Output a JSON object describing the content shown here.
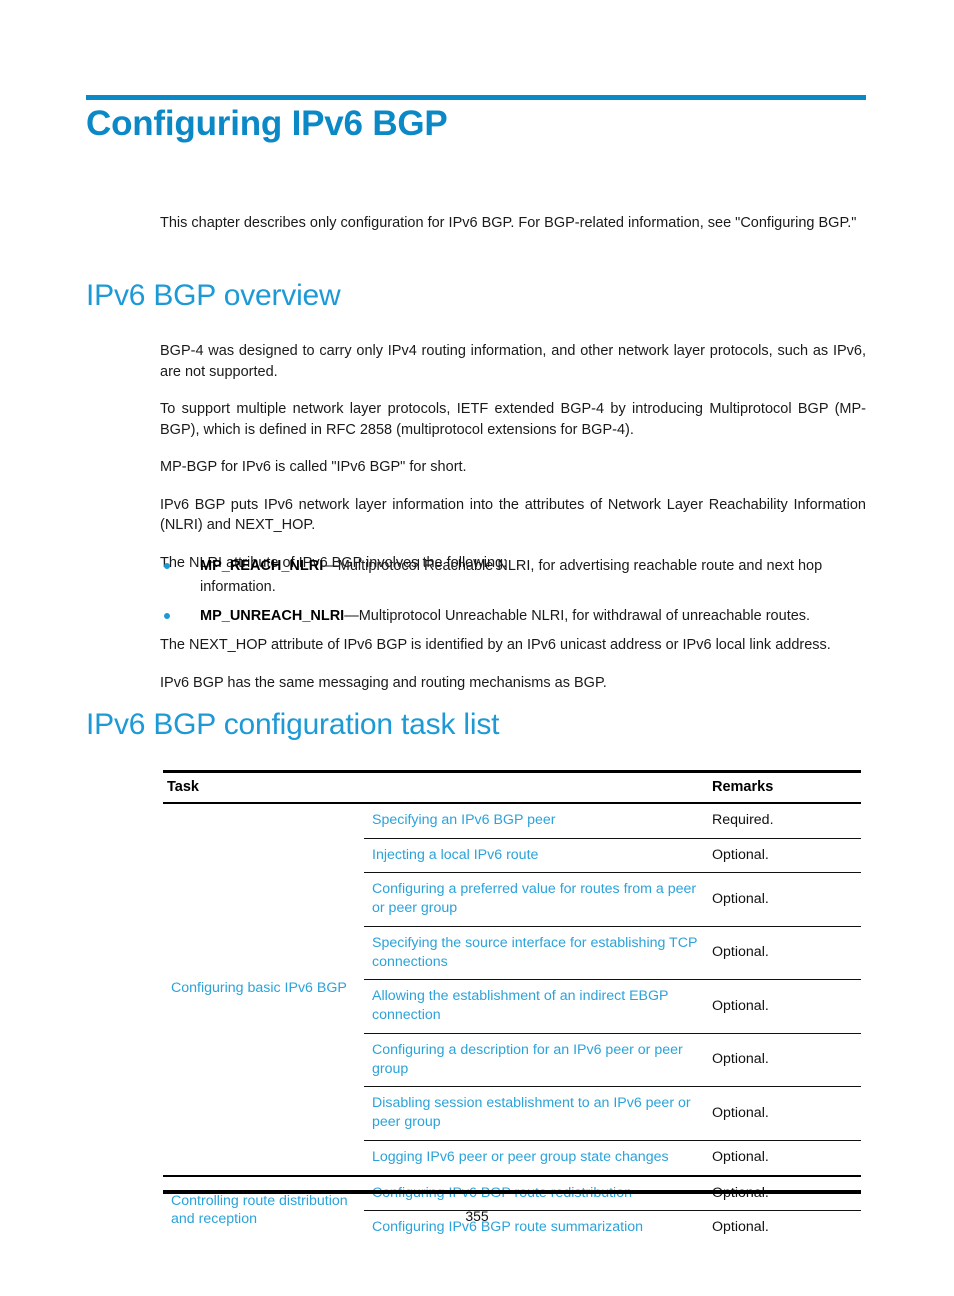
{
  "colors": {
    "chapter_blue": "#0b88c6",
    "heading_blue": "#1d9ad6",
    "link_blue": "#2ba3da",
    "rule_black": "#000000"
  },
  "chapter": {
    "title": "Configuring IPv6 BGP",
    "intro": "This chapter describes only configuration for IPv6 BGP. For BGP-related information, see \"Configuring BGP.\""
  },
  "overview": {
    "heading": "IPv6 BGP overview",
    "paragraphs": [
      "BGP-4 was designed to carry only IPv4 routing information, and other network layer protocols, such as IPv6, are not supported.",
      "To support multiple network layer protocols, IETF extended BGP-4 by introducing Multiprotocol BGP (MP-BGP), which is defined in RFC 2858 (multiprotocol extensions for BGP-4).",
      "MP-BGP for IPv6 is called \"IPv6 BGP\" for short.",
      "IPv6 BGP puts IPv6 network layer information into the attributes of Network Layer Reachability Information (NLRI) and NEXT_HOP.",
      "The NLRI attribute of IPv6 BGP involves the following:"
    ],
    "bullets": [
      {
        "term": "MP_REACH_NLRI",
        "text": "—Multiprotocol Reachable NLRI, for advertising reachable route and next hop information."
      },
      {
        "term": "MP_UNREACH_NLRI",
        "text": "—Multiprotocol Unreachable NLRI, for withdrawal of unreachable routes."
      }
    ],
    "paragraphs_after": [
      "The NEXT_HOP attribute of IPv6 BGP is identified by an IPv6 unicast address or IPv6 local link address.",
      "IPv6 BGP has the same messaging and routing mechanisms as BGP."
    ]
  },
  "task_list": {
    "heading": "IPv6 BGP configuration task list",
    "columns": {
      "group": "Task",
      "task": "",
      "remarks": "Remarks"
    },
    "groups": [
      {
        "label": "Configuring basic IPv6 BGP",
        "rows": [
          {
            "task": "Specifying an IPv6 BGP peer",
            "remarks": "Required."
          },
          {
            "task": "Injecting a local IPv6 route",
            "remarks": "Optional."
          },
          {
            "task": "Configuring a preferred value for routes from a peer or peer group",
            "remarks": "Optional."
          },
          {
            "task": "Specifying the source interface for establishing TCP connections",
            "remarks": "Optional."
          },
          {
            "task": "Allowing the establishment of an indirect EBGP connection",
            "remarks": "Optional."
          },
          {
            "task": "Configuring a description for an IPv6 peer or peer group",
            "remarks": "Optional."
          },
          {
            "task": "Disabling session establishment to an IPv6 peer or peer group",
            "remarks": "Optional."
          },
          {
            "task": "Logging IPv6 peer or peer group state changes",
            "remarks": "Optional."
          }
        ]
      },
      {
        "label": "Controlling route distribution and reception",
        "rows": [
          {
            "task": "Configuring IPv6 BGP route redistribution",
            "remarks": "Optional."
          },
          {
            "task": "Configuring IPv6 BGP route summarization",
            "remarks": "Optional."
          }
        ]
      }
    ]
  },
  "footer": {
    "page_number": "355"
  }
}
